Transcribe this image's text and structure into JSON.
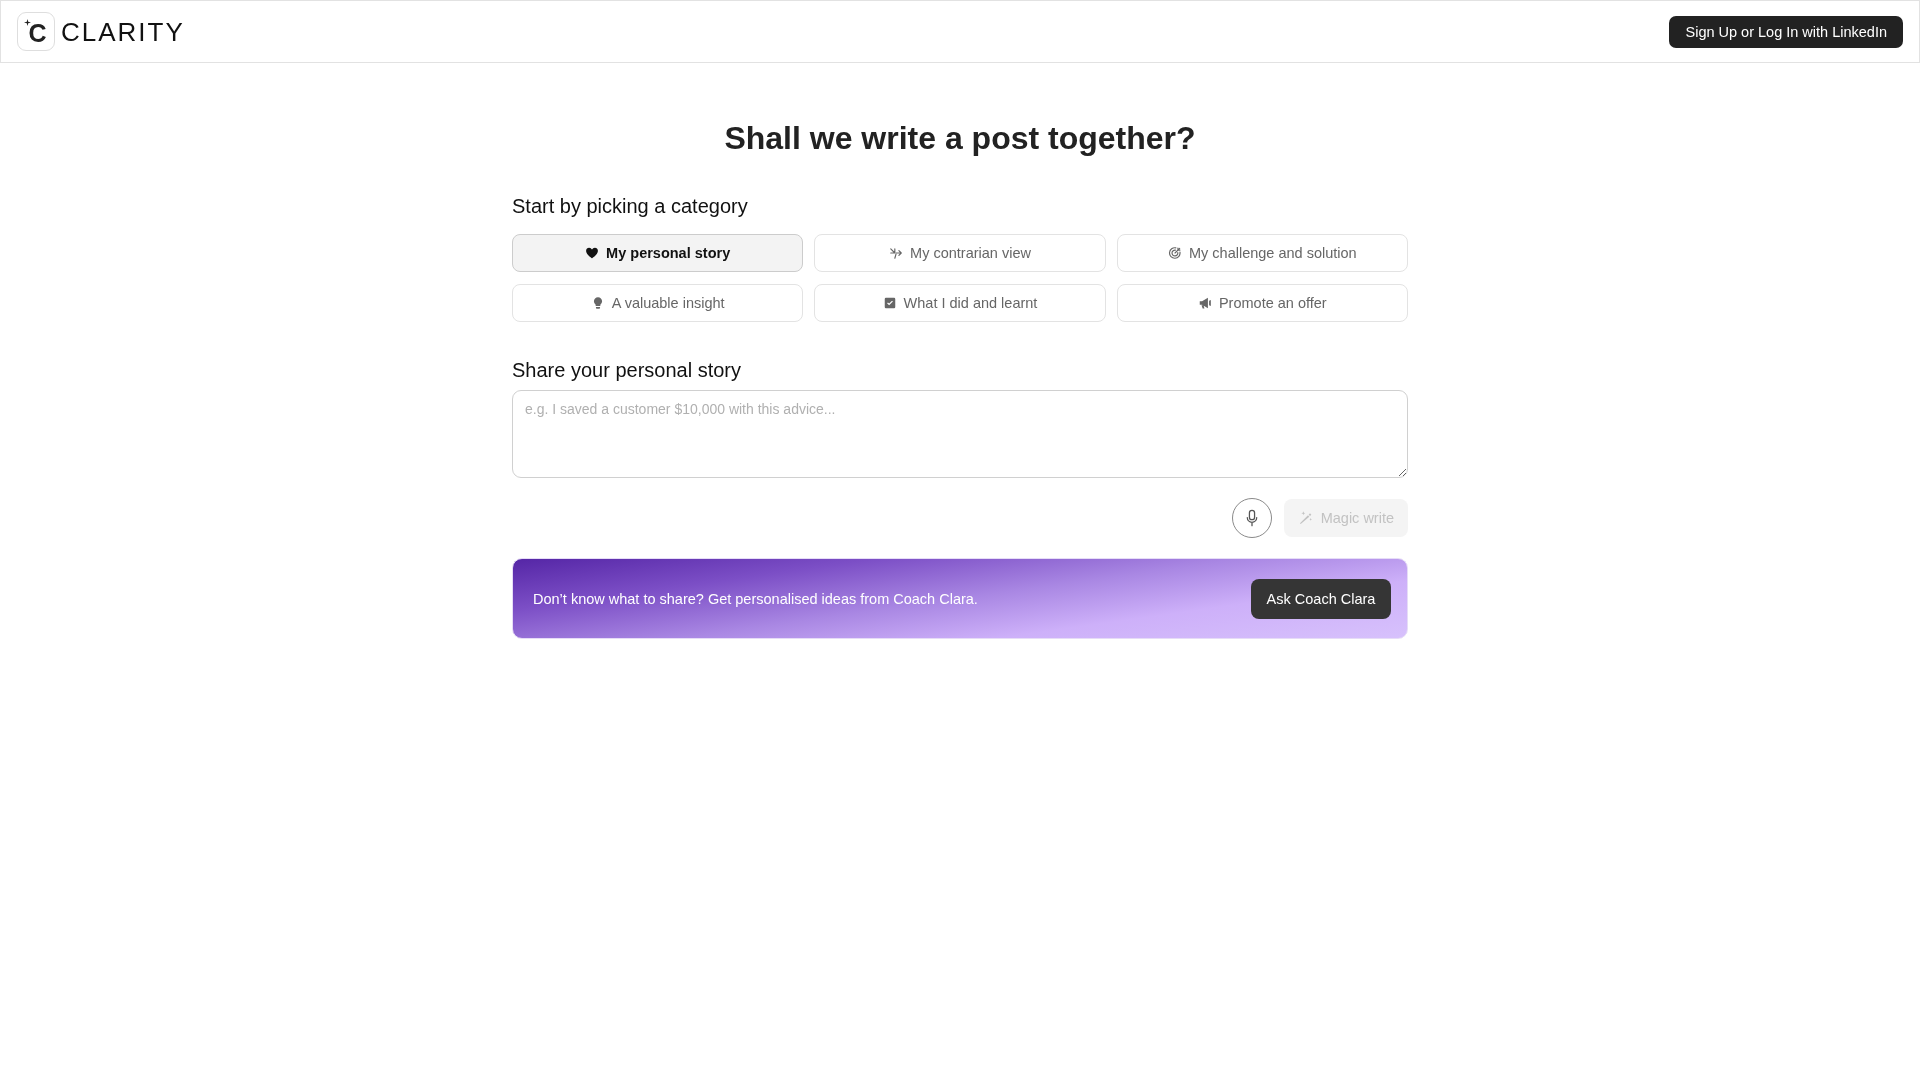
{
  "header": {
    "logo_mark": "C",
    "brand": "CLARITY",
    "login_button": "Sign Up or Log In with LinkedIn"
  },
  "title": "Shall we write a post together?",
  "category_picker": {
    "heading": "Start by picking a category",
    "categories": [
      {
        "label": "My personal story",
        "selected": true
      },
      {
        "label": "My contrarian view",
        "selected": false
      },
      {
        "label": "My challenge and solution",
        "selected": false
      },
      {
        "label": "A valuable insight",
        "selected": false
      },
      {
        "label": "What I did and learnt",
        "selected": false
      },
      {
        "label": "Promote an offer",
        "selected": false
      }
    ]
  },
  "story": {
    "heading": "Share your personal story",
    "placeholder": "e.g. I saved a customer $10,000 with this advice...",
    "magic_write": {
      "label": "Magic write",
      "disabled": true
    }
  },
  "coach_banner": {
    "text": "Don’t know what to share? Get personalised ideas from Coach Clara.",
    "button": "Ask Coach Clara"
  }
}
